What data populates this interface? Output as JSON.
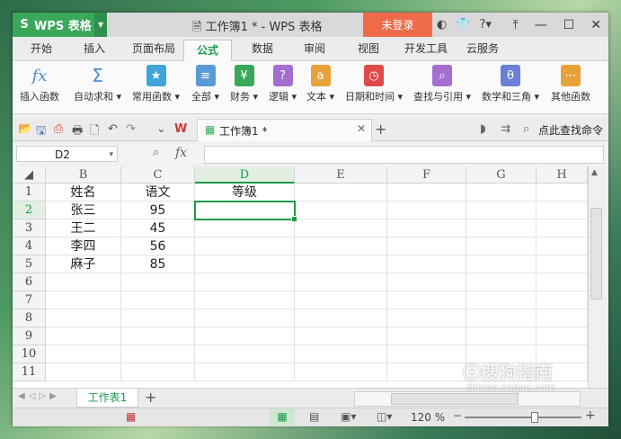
{
  "app": {
    "name": "WPS 表格",
    "doc_title": "工作簿1 * - WPS 表格",
    "login_label": "未登录"
  },
  "menu_tabs": [
    "开始",
    "插入",
    "页面布局",
    "公式",
    "数据",
    "审阅",
    "视图",
    "开发工具",
    "云服务"
  ],
  "active_menu_tab": "公式",
  "ribbon": [
    {
      "label": "插入函数",
      "icon": "fx-icon",
      "glyph": "fx"
    },
    {
      "label": "自动求和 ▾",
      "icon": "sigma-icon",
      "glyph": "Σ"
    },
    {
      "label": "常用函数 ▾",
      "icon": "star-icon",
      "glyph": "★"
    },
    {
      "label": "全部 ▾",
      "icon": "list-icon",
      "glyph": "≡"
    },
    {
      "label": "财务 ▾",
      "icon": "finance-icon",
      "glyph": "¥"
    },
    {
      "label": "逻辑 ▾",
      "icon": "logic-icon",
      "glyph": "?"
    },
    {
      "label": "文本 ▾",
      "icon": "text-icon",
      "glyph": "a"
    },
    {
      "label": "日期和时间 ▾",
      "icon": "clock-icon",
      "glyph": "◷"
    },
    {
      "label": "查找与引用 ▾",
      "icon": "search-icon",
      "glyph": "⌕"
    },
    {
      "label": "数学和三角 ▾",
      "icon": "theta-icon",
      "glyph": "θ"
    },
    {
      "label": "其他函数",
      "icon": "more-icon",
      "glyph": "⋯"
    }
  ],
  "ribbon_colors": [
    "#4a8fd6",
    "#4a8fd6",
    "#3fa5d8",
    "#5b9bd5",
    "#3aa85a",
    "#a46fd0",
    "#e8a23a",
    "#e04a4a",
    "#a46fd0",
    "#6b7fd6",
    "#e8a23a"
  ],
  "document_tab": {
    "label": "工作簿1 *"
  },
  "search_command": {
    "label": "点此查找命令"
  },
  "name_box": {
    "value": "D2"
  },
  "formula_bar": {
    "fx": "fx",
    "value": ""
  },
  "columns": [
    "B",
    "C",
    "D",
    "E",
    "F",
    "G",
    "H"
  ],
  "selected_column": "D",
  "rows": [
    "1",
    "2",
    "3",
    "4",
    "5",
    "6",
    "7",
    "8",
    "9",
    "10",
    "11"
  ],
  "selected_row": "2",
  "table": [
    [
      "姓名",
      "语文",
      "等级"
    ],
    [
      "张三",
      "95",
      ""
    ],
    [
      "王二",
      "45",
      ""
    ],
    [
      "李四",
      "56",
      ""
    ],
    [
      "麻子",
      "85",
      ""
    ]
  ],
  "sheet_tab": {
    "label": "工作表1"
  },
  "status": {
    "zoom": "120 %",
    "zoom_level": 0.6
  },
  "watermark": {
    "text": "搜狗指南",
    "url": "zhinan.sogou.com"
  },
  "colors": {
    "accent": "#1c9a4a",
    "app_green": "#3aa85a",
    "login": "#f06b4a"
  }
}
